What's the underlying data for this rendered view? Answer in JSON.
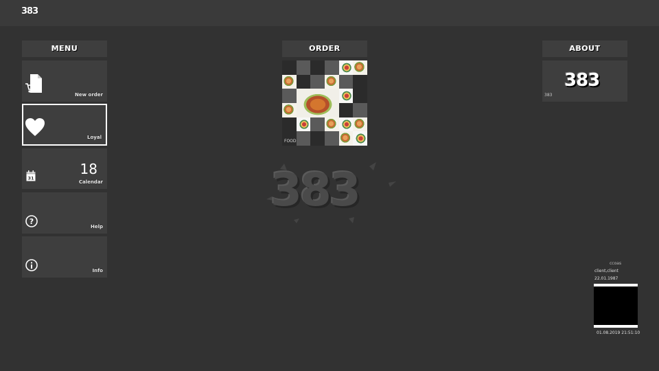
{
  "app": {
    "logo_text": "383"
  },
  "menu": {
    "header": "MENU",
    "tiles": [
      {
        "id": "new-order",
        "label": "New order"
      },
      {
        "id": "favorites",
        "label": "Loyal",
        "selected": true
      },
      {
        "id": "calendar",
        "label": "Calendar",
        "count": "18",
        "calendar_day": "31"
      },
      {
        "id": "help",
        "label": "Help"
      },
      {
        "id": "info",
        "label": "Info"
      }
    ]
  },
  "order": {
    "header": "ORDER",
    "tile_label": "FOOD"
  },
  "about": {
    "header": "ABOUT",
    "logo_text": "383",
    "tag": "383"
  },
  "center": {
    "logo_text": "383"
  },
  "user": {
    "role": "ccoas",
    "name": "client,client",
    "dob": "22.01.1987",
    "datetime": "01.08.2019 21:51:10"
  }
}
